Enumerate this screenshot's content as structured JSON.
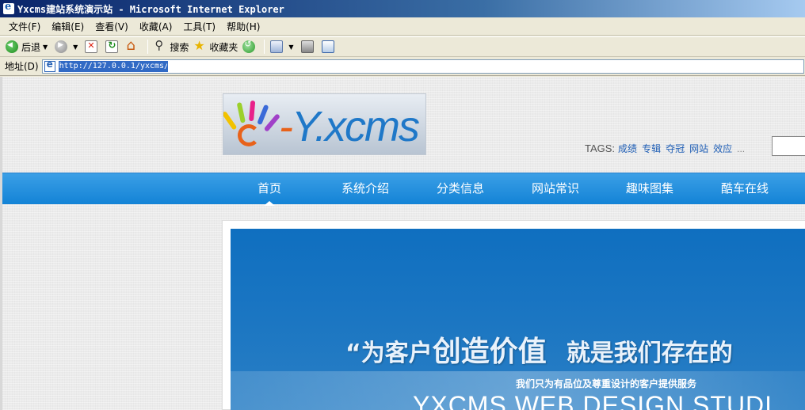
{
  "window": {
    "title": "Yxcms建站系统演示站 - Microsoft Internet Explorer"
  },
  "menubar": {
    "items": [
      "文件(F)",
      "编辑(E)",
      "查看(V)",
      "收藏(A)",
      "工具(T)",
      "帮助(H)"
    ]
  },
  "toolbar": {
    "back_label": "后退",
    "search_label": "搜索",
    "favorites_label": "收藏夹"
  },
  "addressbar": {
    "label": "地址(D)",
    "url": "http://127.0.0.1/yxcms/"
  },
  "site": {
    "logo_text": "Y.xcms",
    "tags_label": "TAGS:",
    "tags": [
      "成绩",
      "专辑",
      "夺冠",
      "网站",
      "效应"
    ],
    "tags_more": "...",
    "nav": [
      "首页",
      "系统介绍",
      "分类信息",
      "网站常识",
      "趣味图集",
      "酷车在线"
    ],
    "nav_active": 0,
    "banner": {
      "slogan_a": "“为客户",
      "slogan_b": "创造价值",
      "slogan_c": "就是我们存在的",
      "subtitle": "我们只为有品位及尊重设计的客户提供服务",
      "studio": "YXCMS WEB DESIGN STUDI"
    }
  },
  "colors": {
    "nav_bg": "#1383d6",
    "banner_bg": "#1b76c2",
    "link": "#1f5eb5",
    "logo_blue": "#1f78c8",
    "logo_orange": "#e8621a"
  }
}
